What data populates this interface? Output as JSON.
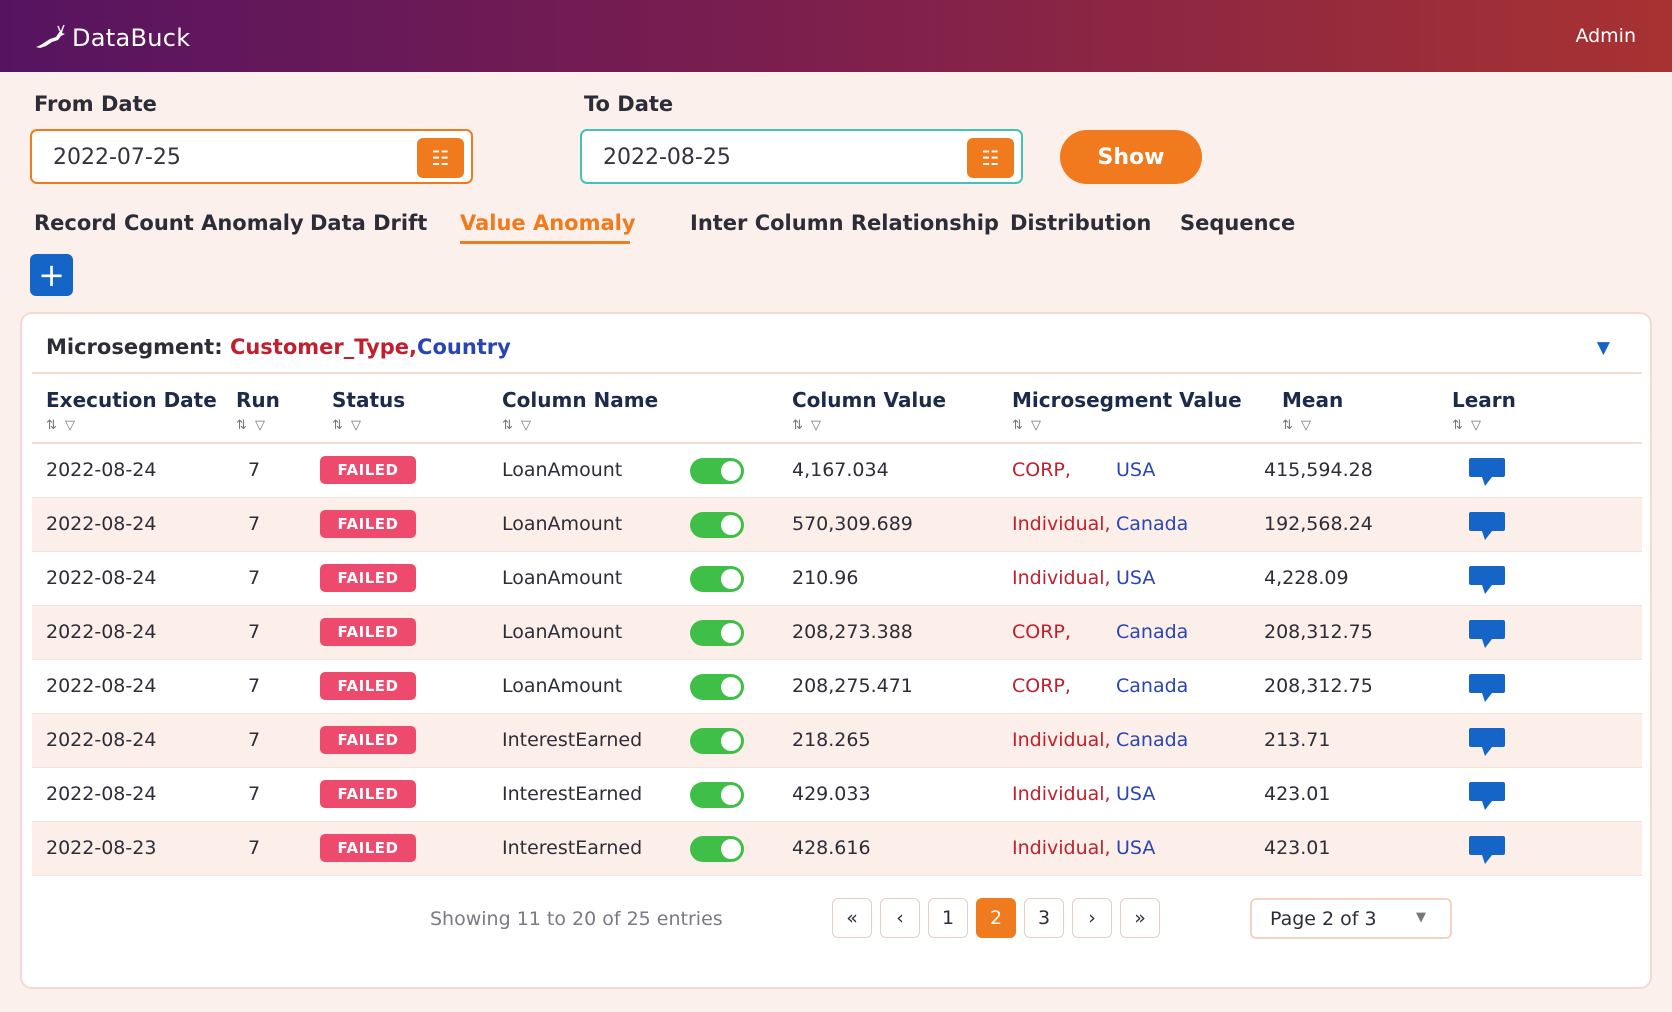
{
  "header": {
    "brand": "DataBuck",
    "logo_icon": "deer-leap-icon",
    "user": "Admin"
  },
  "filters": {
    "from_label": "From Date",
    "from_value": "2022-07-25",
    "to_label": "To Date",
    "to_value": "2022-08-25",
    "calendar_icon": "calendar-icon",
    "show_label": "Show"
  },
  "tabs": [
    {
      "label": "Record Count Anomaly",
      "active": false
    },
    {
      "label": "Data Drift",
      "active": false
    },
    {
      "label": "Value Anomaly",
      "active": true
    },
    {
      "label": "Inter Column Relationship",
      "active": false
    },
    {
      "label": "Distribution",
      "active": false
    },
    {
      "label": "Sequence",
      "active": false
    }
  ],
  "add_label": "+",
  "microsegment": {
    "label": "Microsegment:",
    "value_1": "Customer_Type,",
    "value_2": "Country"
  },
  "columns": [
    "Execution Date",
    "Run",
    "Status",
    "Column Name",
    "Column Value",
    "Microsegment Value",
    "Mean",
    "Learn"
  ],
  "sort_glyph": "⇅ ▽",
  "rows": [
    {
      "date": "2022-08-24",
      "run": "7",
      "status": "FAILED",
      "column": "LoanAmount",
      "enabled": true,
      "value": "4,167.034",
      "seg1": "CORP,",
      "seg2": "USA",
      "mean": "415,594.28"
    },
    {
      "date": "2022-08-24",
      "run": "7",
      "status": "FAILED",
      "column": "LoanAmount",
      "enabled": true,
      "value": "570,309.689",
      "seg1": "Individual,",
      "seg2": "Canada",
      "mean": "192,568.24"
    },
    {
      "date": "2022-08-24",
      "run": "7",
      "status": "FAILED",
      "column": "LoanAmount",
      "enabled": true,
      "value": "210.96",
      "seg1": "Individual,",
      "seg2": "USA",
      "mean": "4,228.09"
    },
    {
      "date": "2022-08-24",
      "run": "7",
      "status": "FAILED",
      "column": "LoanAmount",
      "enabled": true,
      "value": "208,273.388",
      "seg1": "CORP,",
      "seg2": "Canada",
      "mean": "208,312.75"
    },
    {
      "date": "2022-08-24",
      "run": "7",
      "status": "FAILED",
      "column": "LoanAmount",
      "enabled": true,
      "value": "208,275.471",
      "seg1": "CORP,",
      "seg2": "Canada",
      "mean": "208,312.75"
    },
    {
      "date": "2022-08-24",
      "run": "7",
      "status": "FAILED",
      "column": "InterestEarned",
      "enabled": true,
      "value": "218.265",
      "seg1": "Individual,",
      "seg2": "Canada",
      "mean": "213.71"
    },
    {
      "date": "2022-08-24",
      "run": "7",
      "status": "FAILED",
      "column": "InterestEarned",
      "enabled": true,
      "value": "429.033",
      "seg1": "Individual,",
      "seg2": "USA",
      "mean": "423.01"
    },
    {
      "date": "2022-08-23",
      "run": "7",
      "status": "FAILED",
      "column": "InterestEarned",
      "enabled": true,
      "value": "428.616",
      "seg1": "Individual,",
      "seg2": "USA",
      "mean": "423.01"
    }
  ],
  "pagination": {
    "info": "Showing 11 to 20 of 25 entries",
    "first": "«",
    "prev": "‹",
    "pages": [
      "1",
      "2",
      "3"
    ],
    "current": "2",
    "next": "›",
    "last": "»",
    "page_select": "Page 2 of 3"
  },
  "colors": {
    "accent": "#f07b1e",
    "failed": "#ee4a6e",
    "toggle_on": "#40bf48",
    "primary_blue": "#1565c8"
  }
}
